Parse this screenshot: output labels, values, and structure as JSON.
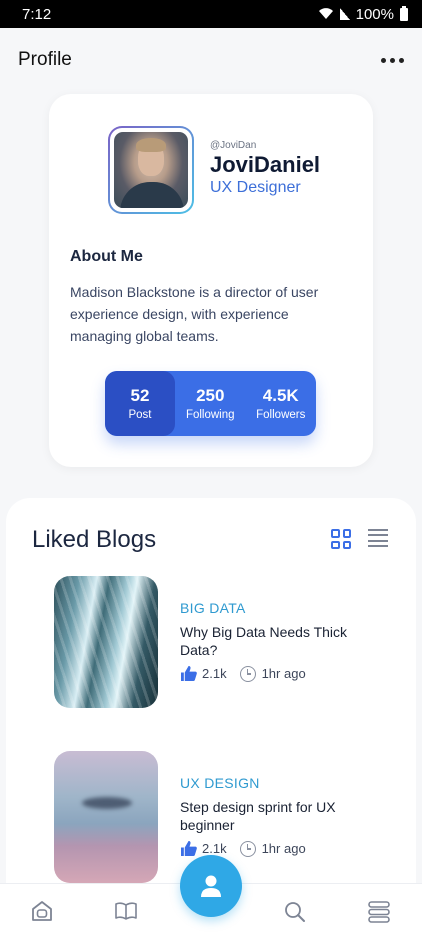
{
  "status_bar": {
    "time": "7:12",
    "battery": "100%"
  },
  "header": {
    "title": "Profile",
    "more_icon": "more-dots-icon"
  },
  "profile": {
    "handle": "@JoviDan",
    "name": "JoviDaniel",
    "role": "UX Designer",
    "about_title": "About Me",
    "about_text": "Madison Blackstone is a director of user experience design, with experience managing global teams.",
    "stats": [
      {
        "value": "52",
        "label": "Post"
      },
      {
        "value": "250",
        "label": "Following"
      },
      {
        "value": "4.5K",
        "label": "Followers"
      }
    ]
  },
  "liked_blogs": {
    "title": "Liked Blogs",
    "items": [
      {
        "category": "BIG DATA",
        "title": "Why Big Data Needs Thick Data?",
        "likes": "2.1k",
        "time": "1hr ago"
      },
      {
        "category": "UX DESIGN",
        "title": "Step design sprint for UX beginner",
        "likes": "2.1k",
        "time": "1hr ago"
      }
    ]
  },
  "bottom_nav": {
    "items": [
      "home-icon",
      "book-icon",
      "profile-icon",
      "search-icon",
      "menu-icon"
    ]
  },
  "colors": {
    "accent": "#3b6ee6",
    "fab": "#2fa8e6",
    "category": "#2f9ad0"
  }
}
